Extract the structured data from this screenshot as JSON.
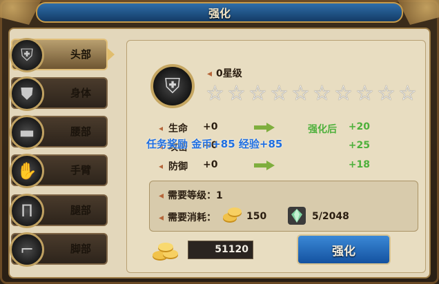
{
  "window": {
    "title": "强化"
  },
  "sidebar": {
    "items": [
      {
        "label": "头部",
        "icon": "helmet-icon",
        "active": true
      },
      {
        "label": "身体",
        "icon": "armor-icon",
        "active": false
      },
      {
        "label": "腰部",
        "icon": "belt-icon",
        "active": false
      },
      {
        "label": "手臂",
        "icon": "gauntlet-icon",
        "active": false
      },
      {
        "label": "腿部",
        "icon": "leggings-icon",
        "active": false
      },
      {
        "label": "脚部",
        "icon": "boots-icon",
        "active": false
      }
    ]
  },
  "equipment": {
    "icon": "helmet-icon",
    "star_level": "0星级",
    "stars_filled": 0,
    "stars_total": 10
  },
  "stats": {
    "after_label": "强化后",
    "rows": [
      {
        "name": "生命",
        "current": "+0",
        "after": "+20"
      },
      {
        "name": "攻击",
        "current": "+0",
        "after": "+25"
      },
      {
        "name": "防御",
        "current": "+0",
        "after": "+18"
      }
    ]
  },
  "overlay_text": "任务奖励 金币+85  经验+85",
  "requirements": {
    "level_label": "需要等级：",
    "level_value": "1",
    "cost_label": "需要消耗：",
    "gold_cost": "150",
    "material_cost": "5/2048"
  },
  "footer": {
    "gold_amount": "51120",
    "enhance_button": "强化"
  },
  "colors": {
    "accent_blue": "#1e6ee0",
    "stat_green": "#4db03b",
    "gold_border": "#c79b4a"
  }
}
